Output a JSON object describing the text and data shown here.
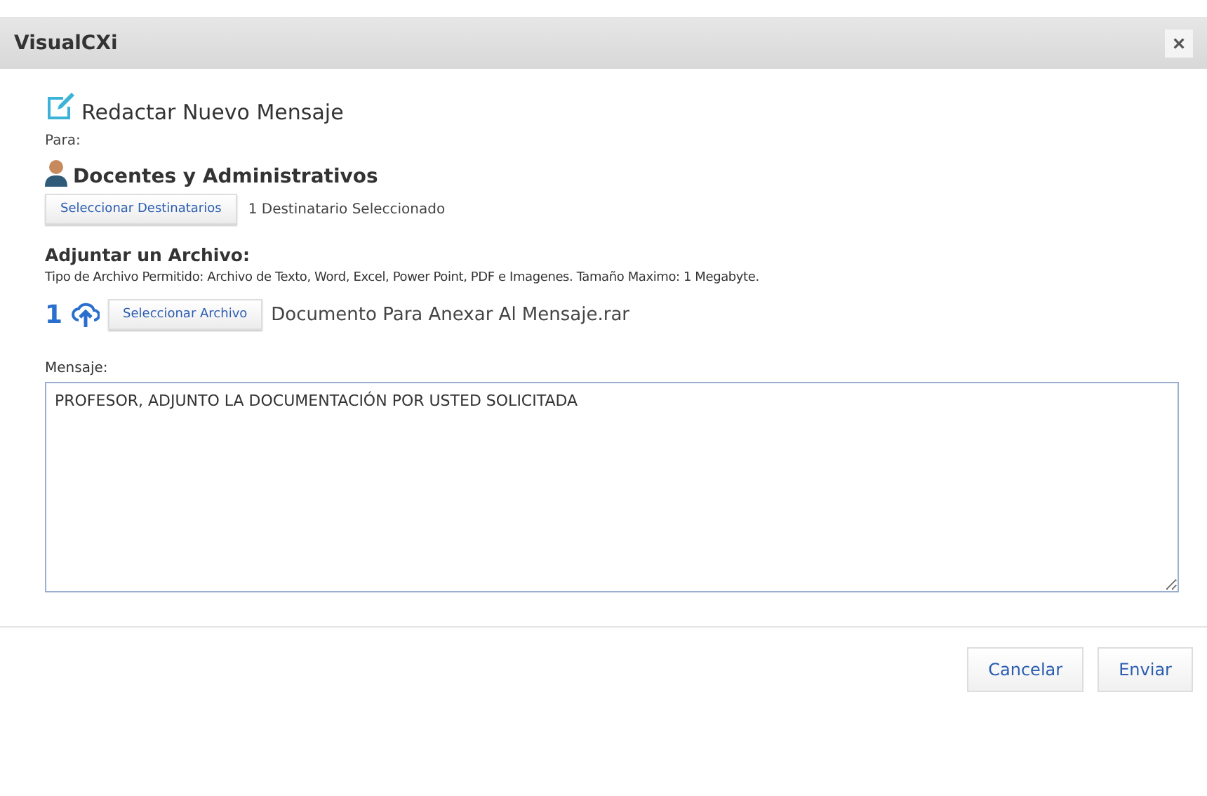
{
  "window": {
    "title": "VisualCXi",
    "close": "×"
  },
  "heading": "Redactar Nuevo Mensaje",
  "to_label": "Para:",
  "recipient_group": "Docentes y Administrativos",
  "select_recipients_button": "Seleccionar Destinatarios",
  "recipients_count": "1 Destinatario Seleccionado",
  "attach_heading": "Adjuntar un Archivo:",
  "attach_hint": "Tipo de Archivo Permitido: Archivo de Texto, Word, Excel, Power Point, PDF e Imagenes. Tamaño Maximo: 1 Megabyte.",
  "upload_count": "1",
  "select_file_button": "Seleccionar Archivo",
  "file_name": "Documento Para Anexar Al Mensaje.rar",
  "message_label": "Mensaje:",
  "message_value": "PROFESOR, ADJUNTO LA DOCUMENTACIÓN POR USTED SOLICITADA",
  "buttons": [
    "Cancelar",
    "Enviar"
  ]
}
